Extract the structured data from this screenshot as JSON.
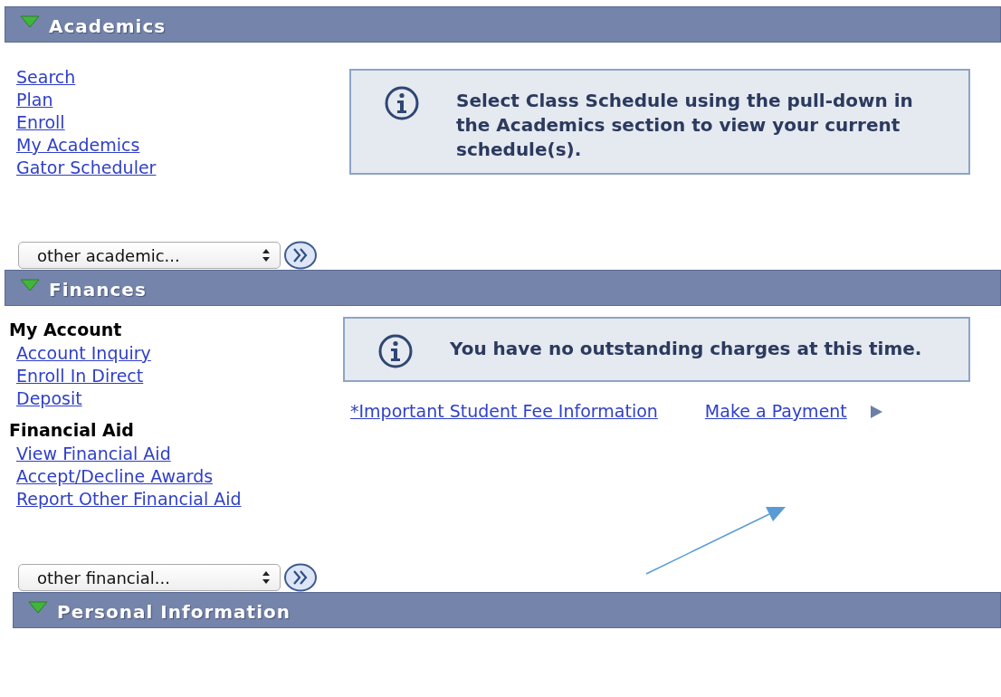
{
  "sections": [
    {
      "title": "Academics",
      "expanded": true,
      "groups": [
        {
          "links": [
            "Search",
            "Plan",
            "Enroll",
            "My Academics",
            "Gator Scheduler"
          ]
        }
      ],
      "dropdown": "other academic...",
      "notice": "Select Class Schedule using the pull-down in the Academics section to view your current schedule(s)."
    },
    {
      "title": "Finances",
      "expanded": true,
      "groups": [
        {
          "heading": "My Account",
          "links": [
            "Account Inquiry",
            "Enroll In Direct",
            "Deposit"
          ]
        },
        {
          "heading": "Financial Aid",
          "links": [
            "View Financial Aid",
            "Accept/Decline Awards",
            "Report Other Financial Aid"
          ]
        }
      ],
      "dropdown": "other financial...",
      "notice": "You have no outstanding charges at this time.",
      "links": [
        "*Important Student Fee Information",
        "Make a Payment"
      ]
    },
    {
      "title": "Personal Information",
      "expanded": true
    }
  ]
}
